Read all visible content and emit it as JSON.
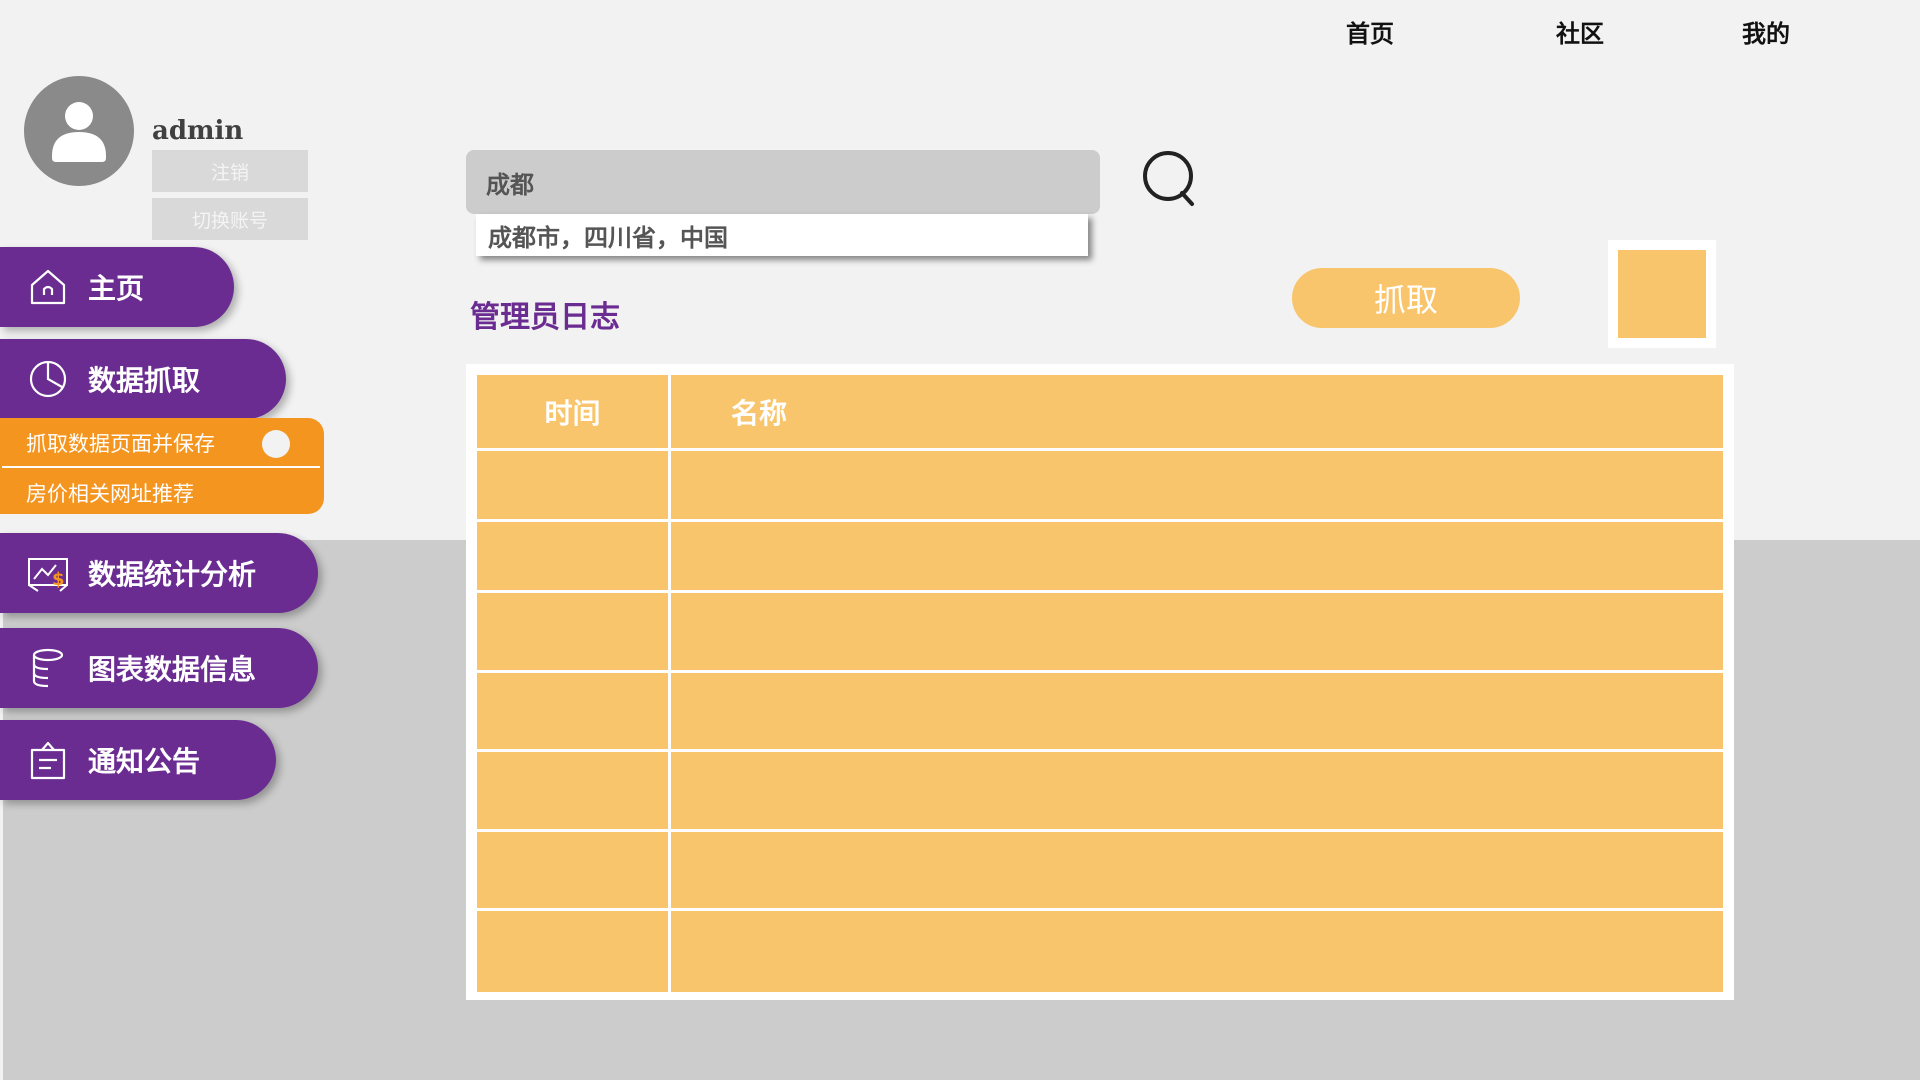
{
  "topnav": {
    "home": "首页",
    "community": "社区",
    "mine": "我的"
  },
  "user": {
    "name": "admin",
    "logout_label": "注销",
    "switch_label": "切换账号"
  },
  "sidebar": {
    "items": [
      {
        "label": "主页",
        "icon": "home-icon"
      },
      {
        "label": "数据抓取",
        "icon": "pie-chart-icon"
      },
      {
        "label": "数据统计分析",
        "icon": "presentation-chart-icon"
      },
      {
        "label": "图表数据信息",
        "icon": "database-icon"
      },
      {
        "label": "通知公告",
        "icon": "notice-icon"
      }
    ],
    "subitems": [
      {
        "label": "抓取数据页面并保存"
      },
      {
        "label": "房价相关网址推荐"
      }
    ]
  },
  "search": {
    "value": "成都",
    "suggestion": "成都市，四川省，中国"
  },
  "main": {
    "title": "管理员日志",
    "grab_label": "抓取",
    "table": {
      "columns": [
        "时间",
        "名称"
      ],
      "rows": [
        [
          "",
          ""
        ],
        [
          "",
          ""
        ],
        [
          "",
          ""
        ],
        [
          "",
          ""
        ],
        [
          "",
          ""
        ],
        [
          "",
          ""
        ],
        [
          "",
          ""
        ]
      ]
    }
  },
  "colors": {
    "purple": "#6a2c91",
    "orange": "#f49520",
    "light_orange": "#f8c56c",
    "background_top": "#f2f2f2",
    "background_bottom": "#cccccc"
  }
}
